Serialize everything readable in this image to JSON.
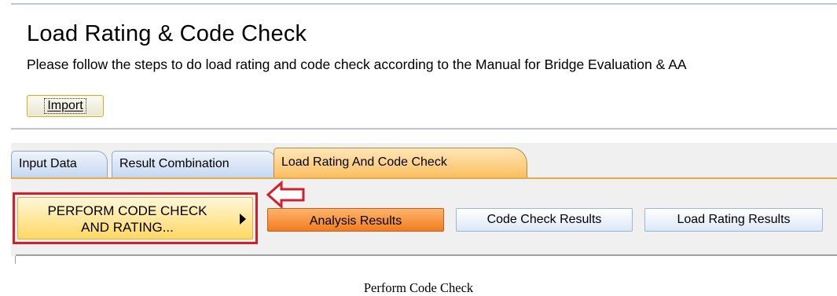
{
  "header": {
    "title": "Load Rating & Code Check",
    "description": "Please follow the steps to do load rating and code check according to the Manual for Bridge Evaluation & AA",
    "import_label": "Import"
  },
  "tabs": [
    {
      "label": "Input Data",
      "active": false
    },
    {
      "label": "Result Combination",
      "active": false
    },
    {
      "label": "Load Rating And Code Check",
      "active": true
    }
  ],
  "toolbar": {
    "perform_line1": "PERFORM CODE CHECK",
    "perform_line2": "AND RATING...",
    "perform_icon": "triangle-right-icon",
    "callout_icon": "left-arrow-outline-icon",
    "analysis_label": "Analysis Results",
    "code_check_label": "Code Check Results",
    "load_rating_label": "Load Rating Results"
  },
  "caption": "Perform Code Check",
  "colors": {
    "highlight_red": "#d31f2b",
    "active_tab": "#fbbf60",
    "analysis_orange": "#f07c22",
    "inactive_tab_blue": "#c5d8f0"
  }
}
